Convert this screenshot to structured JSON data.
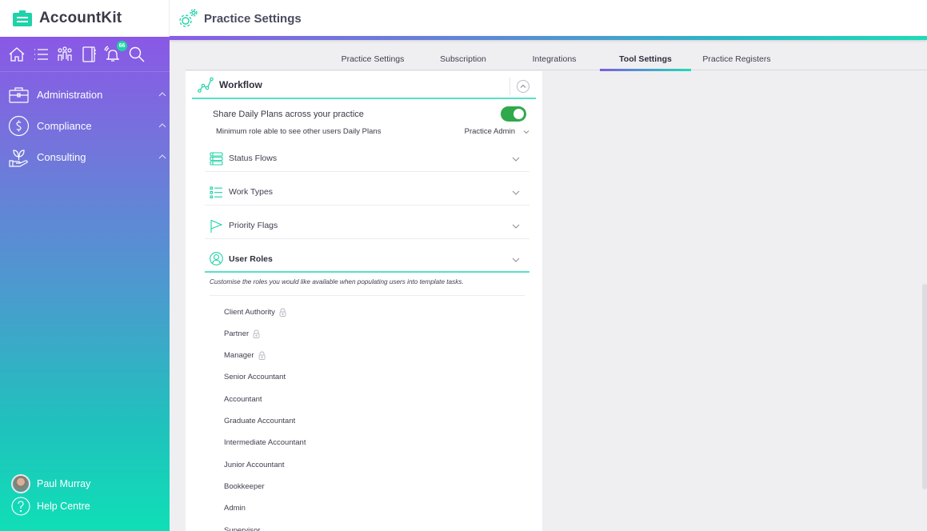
{
  "app": {
    "name": "AccountKit"
  },
  "header": {
    "title": "Practice Settings",
    "title_icon": "gears-icon"
  },
  "sidebar": {
    "quick_nav": [
      {
        "name": "home",
        "icon": "home-icon"
      },
      {
        "name": "tasks",
        "icon": "list-icon"
      },
      {
        "name": "clients",
        "icon": "people-icon"
      },
      {
        "name": "notebook",
        "icon": "notebook-icon"
      },
      {
        "name": "notifications",
        "icon": "bell-icon",
        "badge": "66"
      },
      {
        "name": "search",
        "icon": "search-icon"
      }
    ],
    "items": [
      {
        "label": "Administration",
        "icon": "briefcase-icon",
        "expanded": true
      },
      {
        "label": "Compliance",
        "icon": "dollar-icon",
        "expanded": true
      },
      {
        "label": "Consulting",
        "icon": "hand-plant-icon",
        "expanded": true
      }
    ],
    "user": {
      "name": "Paul Murray"
    },
    "help": {
      "label": "Help Centre"
    }
  },
  "tabs": [
    {
      "label": "Practice Settings",
      "active": false
    },
    {
      "label": "Subscription",
      "active": false
    },
    {
      "label": "Integrations",
      "active": false
    },
    {
      "label": "Tool Settings",
      "active": true
    },
    {
      "label": "Practice Registers",
      "active": false
    }
  ],
  "workflow": {
    "title": "Workflow",
    "share_daily_plans": {
      "label": "Share Daily Plans across your practice",
      "enabled": true
    },
    "min_role": {
      "label": "Minimum role able to see other users Daily Plans",
      "value": "Practice Admin"
    },
    "sections": [
      {
        "label": "Status Flows",
        "icon": "status-flow-icon",
        "expanded": false
      },
      {
        "label": "Work Types",
        "icon": "list-icon",
        "expanded": false
      },
      {
        "label": "Priority Flags",
        "icon": "flag-icon",
        "expanded": false
      },
      {
        "label": "User Roles",
        "icon": "user-icon",
        "expanded": true
      }
    ],
    "user_roles": {
      "description": "Customise the roles you would like available when populating users into template tasks.",
      "roles": [
        {
          "label": "Client Authority",
          "locked": true
        },
        {
          "label": "Partner",
          "locked": true
        },
        {
          "label": "Manager",
          "locked": true
        },
        {
          "label": "Senior Accountant",
          "locked": false
        },
        {
          "label": "Accountant",
          "locked": false
        },
        {
          "label": "Graduate Accountant",
          "locked": false
        },
        {
          "label": "Intermediate Accountant",
          "locked": false
        },
        {
          "label": "Junior Accountant",
          "locked": false
        },
        {
          "label": "Bookkeeper",
          "locked": false
        },
        {
          "label": "Admin",
          "locked": false
        },
        {
          "label": "Supervisor",
          "locked": false
        }
      ]
    }
  },
  "colors": {
    "brand": "#1dd3a8",
    "accent_purple": "#8a58e6",
    "toggle_on": "#2fa94b",
    "section_underline": "#58e0c8"
  }
}
